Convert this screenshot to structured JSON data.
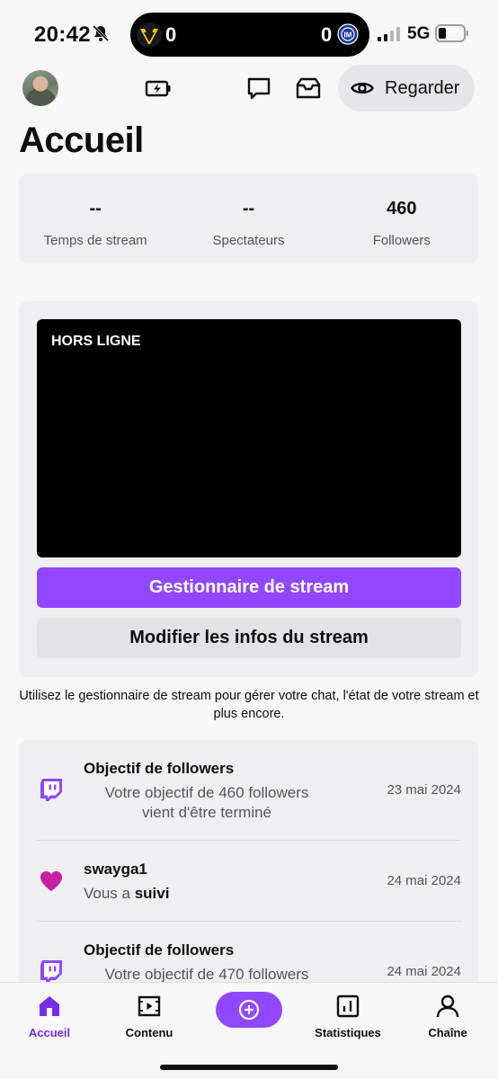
{
  "status_bar": {
    "time": "20:42",
    "score_left": "0",
    "score_right": "0",
    "network": "5G"
  },
  "header": {
    "watch_label": "Regarder"
  },
  "page": {
    "title": "Accueil"
  },
  "stats": [
    {
      "value": "--",
      "label": "Temps de stream"
    },
    {
      "value": "--",
      "label": "Spectateurs"
    },
    {
      "value": "460",
      "label": "Followers"
    }
  ],
  "stream": {
    "status": "HORS LIGNE",
    "manager_label": "Gestionnaire de stream",
    "edit_label": "Modifier les infos du stream",
    "hint": "Utilisez le gestionnaire de stream pour gérer votre chat, l'état de votre stream et plus encore."
  },
  "activity": [
    {
      "icon": "twitch-glitch-icon",
      "title": "Objectif de followers",
      "line1": "Votre objectif de 460 followers",
      "line2": "vient d'être terminé",
      "date": "23 mai 2024"
    },
    {
      "icon": "heart-icon",
      "title": "swayga1",
      "prefix": "Vous a ",
      "bold": "suivi",
      "date": "24 mai 2024"
    },
    {
      "icon": "twitch-glitch-icon",
      "title": "Objectif de followers",
      "line1": "Votre objectif de 470 followers",
      "date": "24 mai 2024"
    }
  ],
  "tabs": [
    {
      "label": "Accueil",
      "icon": "home-icon",
      "active": true
    },
    {
      "label": "Contenu",
      "icon": "video-icon"
    },
    {
      "label": "",
      "icon": "plus-icon"
    },
    {
      "label": "Statistiques",
      "icon": "bar-chart-icon"
    },
    {
      "label": "Chaîne",
      "icon": "person-icon"
    }
  ],
  "colors": {
    "accent": "#9147ff",
    "heart": "#c81fa4",
    "active_tab": "#772ce8"
  }
}
